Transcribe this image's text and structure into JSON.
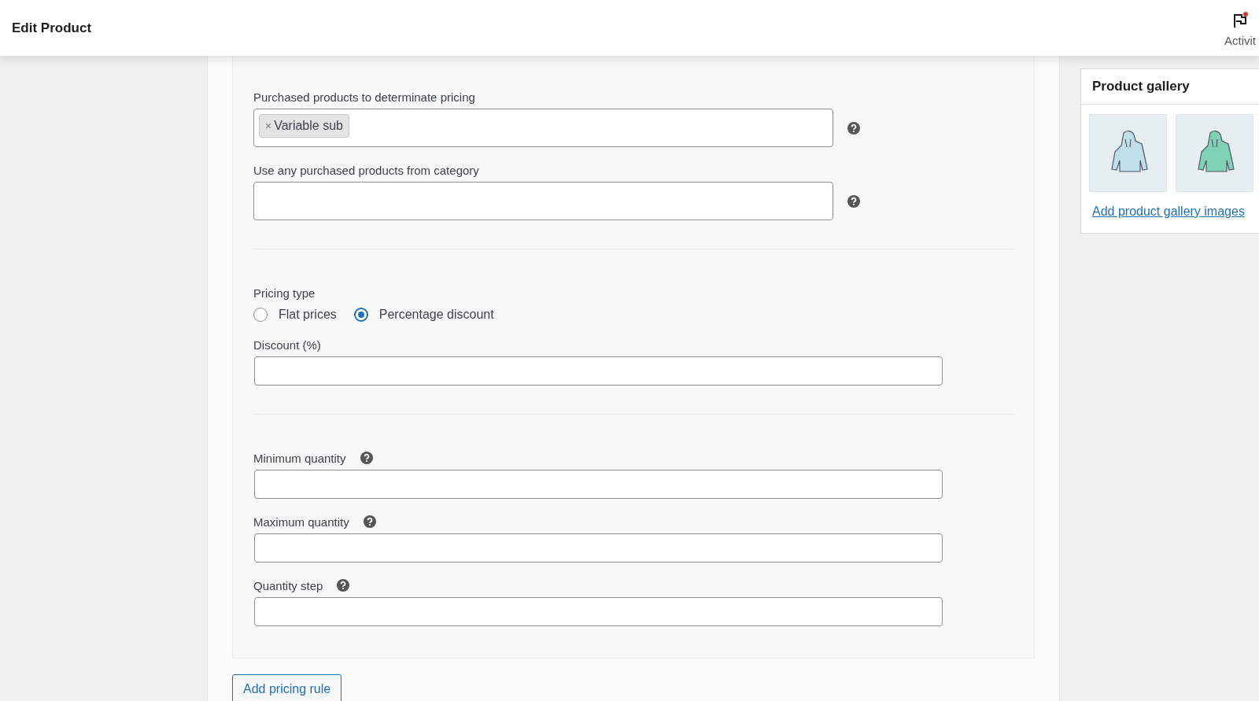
{
  "header": {
    "title": "Edit Product",
    "activity_label": "Activit",
    "activity_unread": true
  },
  "sections": [
    {
      "fields": [
        {
          "kind": "tags",
          "label": "Purchased products to determinate pricing",
          "tags": [
            {
              "remove_symbol": "×",
              "label": "Variable sub"
            }
          ],
          "help": true
        },
        {
          "kind": "tags",
          "label": "Use any purchased products from category",
          "help": true
        }
      ]
    },
    {
      "fields": [
        {
          "kind": "radio",
          "label": "Pricing type",
          "options": [
            {
              "label": "Flat prices",
              "selected": false
            },
            {
              "label": "Percentage discount",
              "selected": true
            }
          ]
        },
        {
          "kind": "text",
          "label": "Discount (%)",
          "help": false
        }
      ]
    },
    {
      "fields": [
        {
          "kind": "text",
          "label": "Minimum quantity",
          "help": true
        },
        {
          "kind": "text",
          "label": "Maximum quantity",
          "help": true
        },
        {
          "kind": "text",
          "label": "Quantity step",
          "help": true
        }
      ]
    }
  ],
  "add_button": "Add pricing rule",
  "gallery": {
    "title": "Product gallery",
    "images": [
      {
        "color": "#bfe0ea"
      },
      {
        "color": "#7fd3b4"
      }
    ],
    "link": "Add product gallery images"
  }
}
